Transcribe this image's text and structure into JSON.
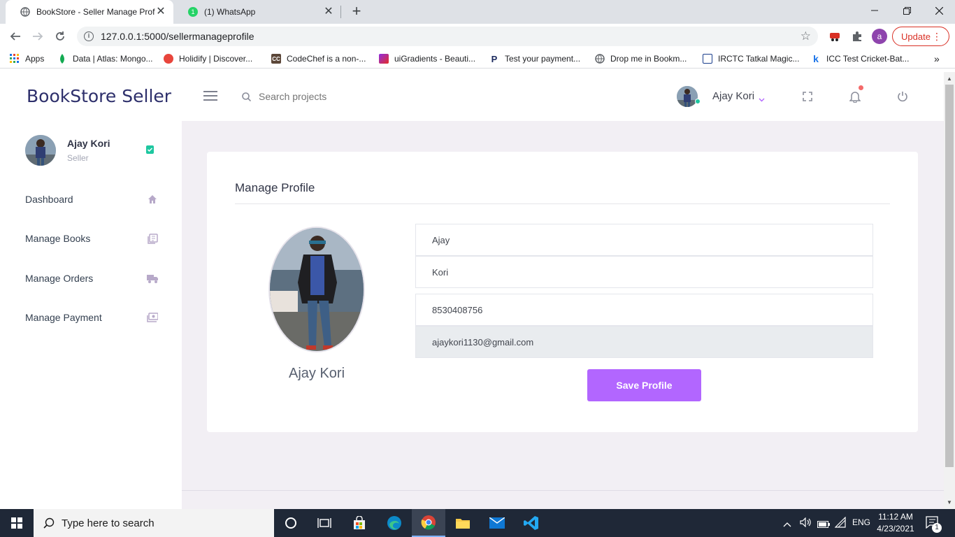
{
  "browser": {
    "tabs": [
      {
        "title": "BookStore - Seller Manage Profile",
        "active": true
      },
      {
        "title": "(1) WhatsApp",
        "active": false
      }
    ],
    "url": "127.0.0.1:5000/sellermanageprofile",
    "profile_letter": "a",
    "update_label": "Update",
    "bookmarks": [
      {
        "label": "Apps",
        "icon": "apps-grid-icon"
      },
      {
        "label": "Data | Atlas: Mongo...",
        "icon": "mongodb-leaf-icon"
      },
      {
        "label": "Holidify | Discover...",
        "icon": "holidify-icon"
      },
      {
        "label": "CodeChef is a non-...",
        "icon": "codechef-icon"
      },
      {
        "label": "uiGradients - Beauti...",
        "icon": "uigradients-icon"
      },
      {
        "label": "Test your payment...",
        "icon": "paypal-icon"
      },
      {
        "label": "Drop me in Bookm...",
        "icon": "globe-icon"
      },
      {
        "label": "IRCTC Tatkal Magic...",
        "icon": "irctc-icon"
      },
      {
        "label": "ICC Test Cricket-Bat...",
        "icon": "icc-k-icon"
      }
    ]
  },
  "app": {
    "brand": "BookStore Seller",
    "search_placeholder": "Search projects",
    "topbar_user": "Ajay Kori",
    "sidebar": {
      "user_name": "Ajay Kori",
      "user_role": "Seller",
      "items": [
        {
          "label": "Dashboard",
          "icon": "home-icon"
        },
        {
          "label": "Manage Books",
          "icon": "books-icon"
        },
        {
          "label": "Manage Orders",
          "icon": "truck-icon"
        },
        {
          "label": "Manage Payment",
          "icon": "payment-icon"
        }
      ]
    },
    "profile": {
      "title": "Manage Profile",
      "display_name": "Ajay Kori",
      "first_name": "Ajay",
      "last_name": "Kori",
      "phone": "8530408756",
      "email": "ajaykori1130@gmail.com",
      "save_label": "Save Profile"
    },
    "colors": {
      "accent": "#b266ff",
      "brand": "#2d2f6b",
      "content_bg": "#f2eff4",
      "online": "#1ec7a0",
      "notify": "#f46a6a"
    }
  },
  "taskbar": {
    "search_placeholder": "Type here to search",
    "language": "ENG",
    "time": "11:12 AM",
    "date": "4/23/2021",
    "notification_count": "1"
  }
}
